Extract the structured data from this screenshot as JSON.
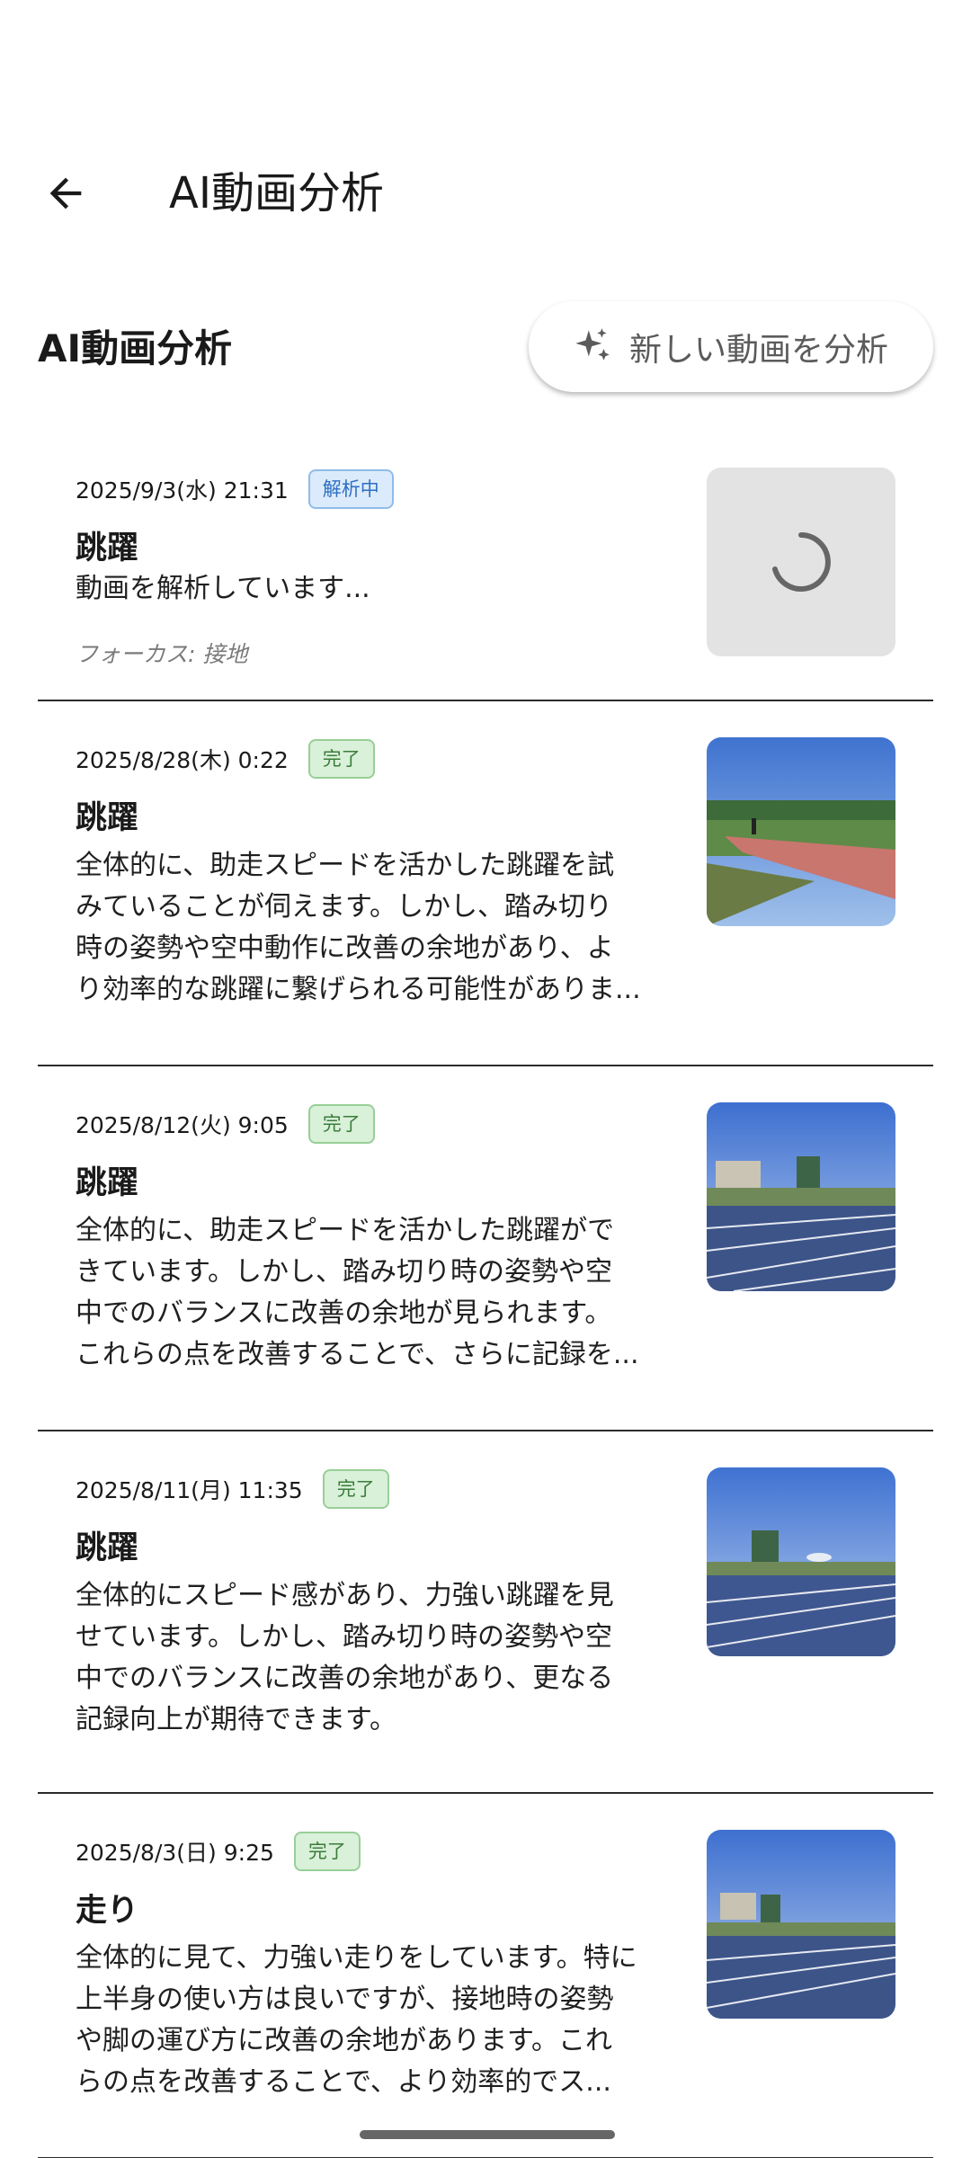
{
  "appbar": {
    "title": "AI動画分析"
  },
  "section": {
    "title": "AI動画分析",
    "new_button_label": "新しい動画を分析"
  },
  "items": [
    {
      "date": "2025/9/3(水) 21:31",
      "status": "解析中",
      "status_type": "analyzing",
      "title": "跳躍",
      "lines": [
        "動画を解析しています..."
      ],
      "focus": "フォーカス: 接地",
      "thumb": "loading"
    },
    {
      "date": "2025/8/28(木) 0:22",
      "status": "完了",
      "status_type": "done",
      "title": "跳躍",
      "lines": [
        "全体的に、助走スピードを活かした跳躍を試",
        "みていることが伺えます。しかし、踏み切り",
        "時の姿勢や空中動作に改善の余地があり、よ",
        "り効率的な跳躍に繋げられる可能性がありま..."
      ],
      "thumb": "track-red"
    },
    {
      "date": "2025/8/12(火) 9:05",
      "status": "完了",
      "status_type": "done",
      "title": "跳躍",
      "lines": [
        "全体的に、助走スピードを活かした跳躍がで",
        "きています。しかし、踏み切り時の姿勢や空",
        "中でのバランスに改善の余地が見られます。",
        "これらの点を改善することで、さらに記録を..."
      ],
      "thumb": "track-blue"
    },
    {
      "date": "2025/8/11(月) 11:35",
      "status": "完了",
      "status_type": "done",
      "title": "跳躍",
      "lines": [
        "全体的にスピード感があり、力強い跳躍を見",
        "せています。しかし、踏み切り時の姿勢や空",
        "中でのバランスに改善の余地があり、更なる",
        "記録向上が期待できます。"
      ],
      "thumb": "track-blue"
    },
    {
      "date": "2025/8/3(日) 9:25",
      "status": "完了",
      "status_type": "done",
      "title": "走り",
      "lines": [
        "全体的に見て、力強い走りをしています。特に",
        "上半身の使い方は良いですが、接地時の姿勢",
        "や脚の運び方に改善の余地があります。これ",
        "らの点を改善することで、より効率的でス..."
      ],
      "thumb": "track-blue"
    }
  ]
}
